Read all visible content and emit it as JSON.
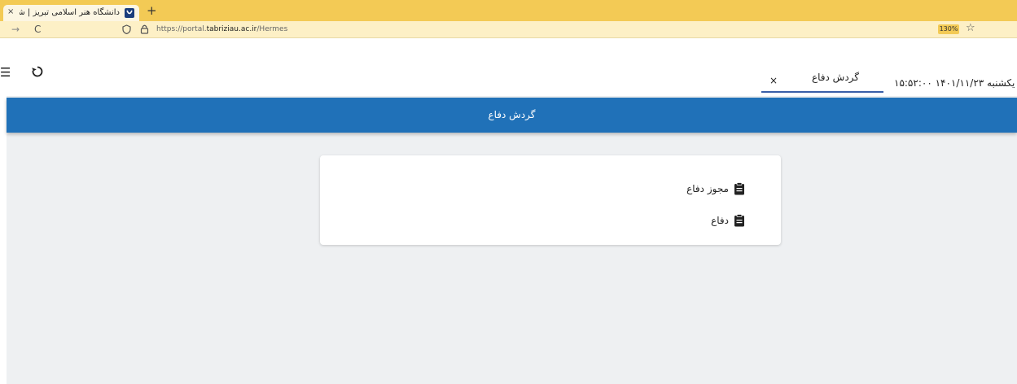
{
  "browser": {
    "tab_title": "دانشگاه هنر اسلامی تبریز | شرکت",
    "tab_close": "×",
    "new_tab": "+",
    "url_prefix": "https://portal.",
    "url_domain": "tabriziau.ac.ir",
    "url_path": "/Hermes",
    "zoom": "130%",
    "forward": "→",
    "reload": "C",
    "bookmark": "☆"
  },
  "app": {
    "menu_glyph": "☰",
    "open_tab": {
      "label": "گردش دفاع",
      "close": "×"
    },
    "datetime": "۱۵:۵۲:۰۰ یکشنبه ۱۴۰۱/۱۱/۲۳",
    "header_title": "گردش دفاع",
    "items": [
      {
        "label": "مجوز دفاع",
        "icon": "clipboard-icon"
      },
      {
        "label": "دفاع",
        "icon": "clipboard-icon"
      }
    ]
  },
  "colors": {
    "browser_accent": "#f3ca55",
    "header_blue": "#2071b8",
    "tab_underline": "#3a5fa8"
  }
}
